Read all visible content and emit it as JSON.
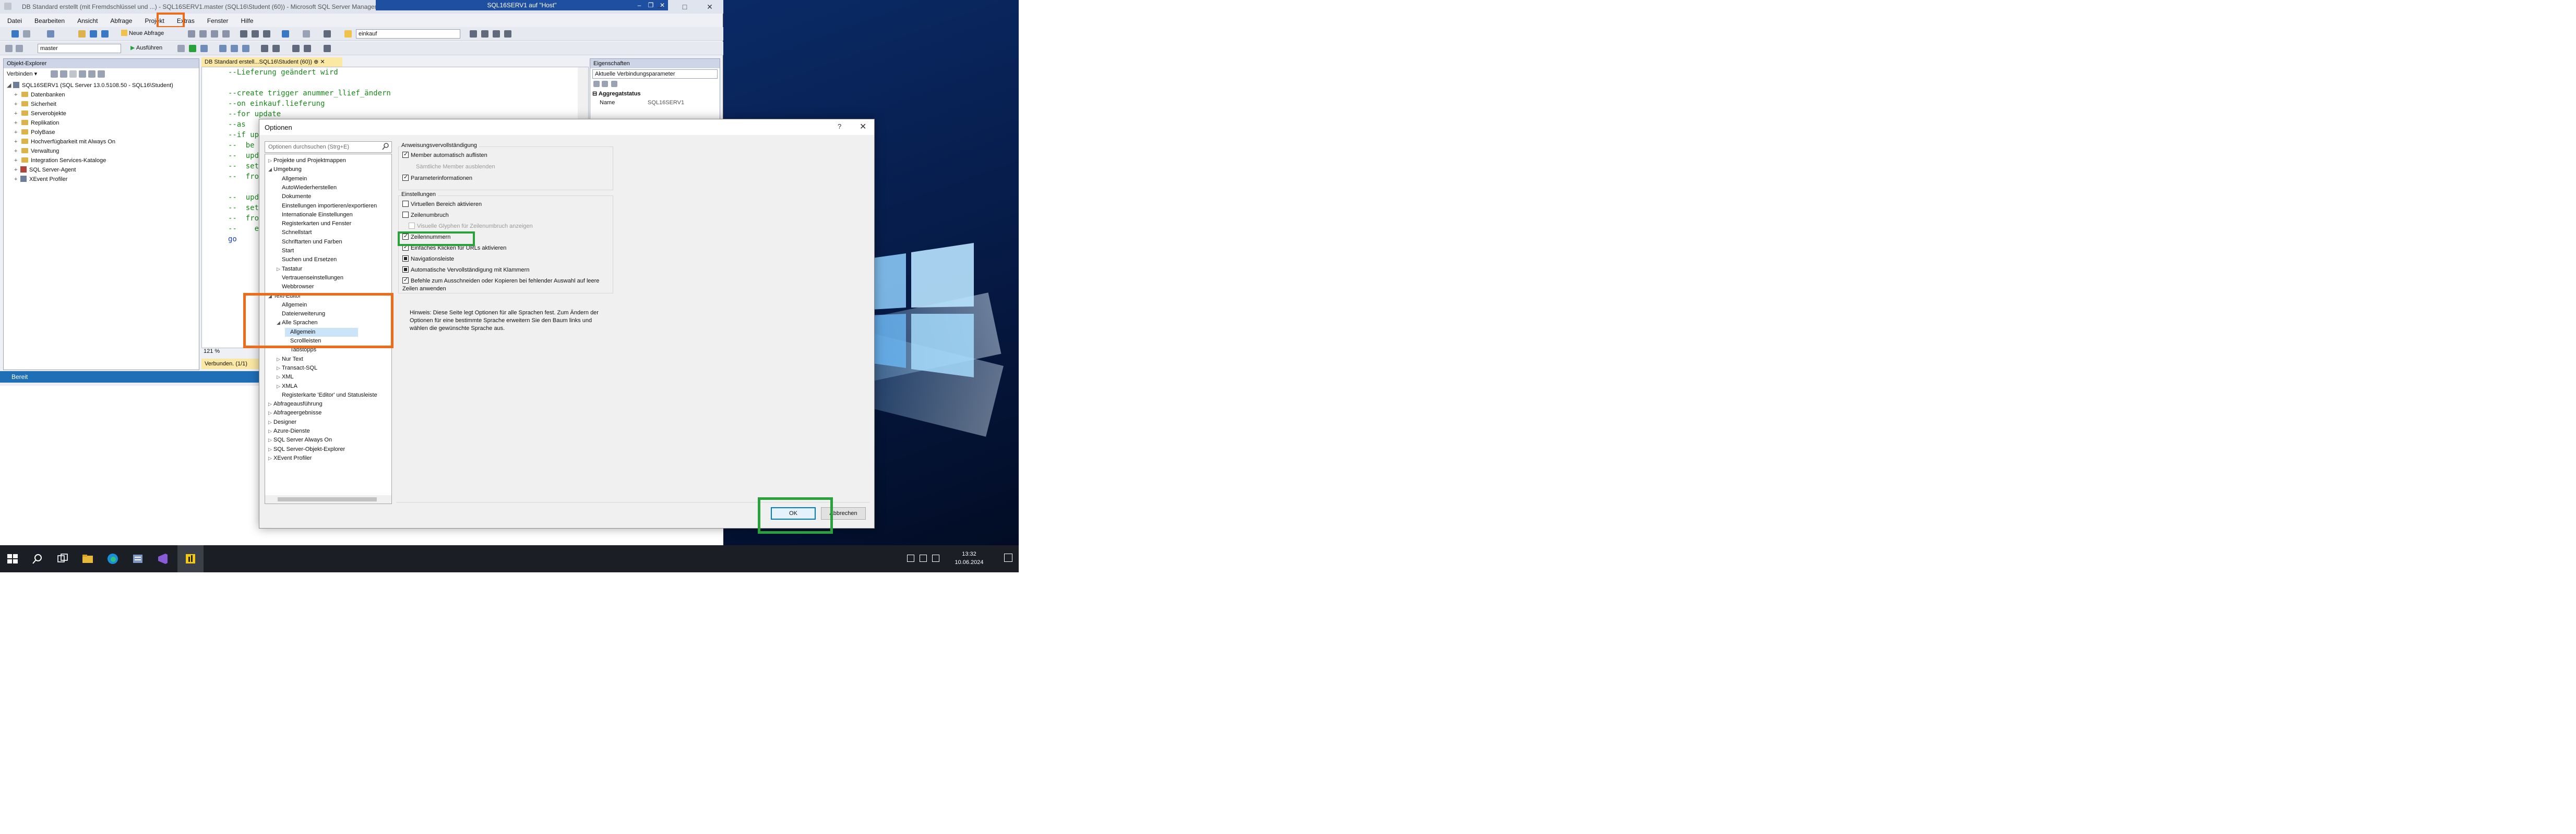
{
  "window": {
    "title": "DB Standard erstellt (mit Fremdschlüssel und ...) - SQL16SERV1.master (SQL16\\Student (60)) - Microsoft SQL Server Management Studio",
    "rdp_title": "SQL16SERV1 auf \"Host\""
  },
  "menu": [
    "Datei",
    "Bearbeiten",
    "Ansicht",
    "Abfrage",
    "Projekt",
    "Extras",
    "Fenster",
    "Hilfe"
  ],
  "toolbar": {
    "new_query": "Neue Abfrage",
    "db_select": "master",
    "execute": "Ausführen",
    "search_box": "einkauf"
  },
  "object_explorer": {
    "title": "Objekt-Explorer",
    "connect": "Verbinden",
    "server": "SQL16SERV1 (SQL Server 13.0.5108.50 - SQL16\\Student)",
    "items": [
      "Datenbanken",
      "Sicherheit",
      "Serverobjekte",
      "Replikation",
      "PolyBase",
      "Hochverfügbarkeit mit Always On",
      "Verwaltung",
      "Integration Services-Kataloge",
      "SQL Server-Agent",
      "XEvent Profiler"
    ]
  },
  "editor": {
    "tab": "DB Standard erstell...SQL16\\Student (60))",
    "lines": [
      "--Lieferung geändert wird",
      "",
      "--create trigger anummer_llief_ändern",
      "--on einkauf.lieferung",
      "--for update",
      "--as",
      "--if up",
      "--  be",
      "--  upd",
      "--  set",
      "--  fro",
      "",
      "--  upd",
      "--  set",
      "--  fro",
      "--    e",
      "go"
    ],
    "zoom": "121 %",
    "connected": "Verbunden. (1/1)"
  },
  "properties": {
    "title": "Eigenschaften",
    "selector": "Aktuelle Verbindungsparameter",
    "section": "Aggregatstatus",
    "row_label": "Name",
    "row_value": "SQL16SERV1"
  },
  "status_bar": "Bereit",
  "dialog": {
    "title": "Optionen",
    "help": "?",
    "close": "✕",
    "search_placeholder": "Optionen durchsuchen (Strg+E)",
    "tree": [
      {
        "label": "Projekte und Projektmappen",
        "indent": 0,
        "arrow": "▷"
      },
      {
        "label": "Umgebung",
        "indent": 0,
        "arrow": "◢"
      },
      {
        "label": "Allgemein",
        "indent": 1,
        "arrow": ""
      },
      {
        "label": "AutoWiederherstellen",
        "indent": 1,
        "arrow": ""
      },
      {
        "label": "Dokumente",
        "indent": 1,
        "arrow": ""
      },
      {
        "label": "Einstellungen importieren/exportieren",
        "indent": 1,
        "arrow": ""
      },
      {
        "label": "Internationale Einstellungen",
        "indent": 1,
        "arrow": ""
      },
      {
        "label": "Registerkarten und Fenster",
        "indent": 1,
        "arrow": ""
      },
      {
        "label": "Schnellstart",
        "indent": 1,
        "arrow": ""
      },
      {
        "label": "Schriftarten und Farben",
        "indent": 1,
        "arrow": ""
      },
      {
        "label": "Start",
        "indent": 1,
        "arrow": ""
      },
      {
        "label": "Suchen und Ersetzen",
        "indent": 1,
        "arrow": ""
      },
      {
        "label": "Tastatur",
        "indent": 1,
        "arrow": "▷"
      },
      {
        "label": "Vertrauenseinstellungen",
        "indent": 1,
        "arrow": ""
      },
      {
        "label": "Webbrowser",
        "indent": 1,
        "arrow": ""
      },
      {
        "label": "Text-Editor",
        "indent": 0,
        "arrow": "◢"
      },
      {
        "label": "Allgemein",
        "indent": 1,
        "arrow": ""
      },
      {
        "label": "Dateierweiterung",
        "indent": 1,
        "arrow": ""
      },
      {
        "label": "Alle Sprachen",
        "indent": 1,
        "arrow": "◢"
      },
      {
        "label": "Allgemein",
        "indent": 2,
        "arrow": "",
        "selected": true
      },
      {
        "label": "Scrollleisten",
        "indent": 2,
        "arrow": ""
      },
      {
        "label": "Tabstopps",
        "indent": 2,
        "arrow": ""
      },
      {
        "label": "Nur Text",
        "indent": 1,
        "arrow": "▷"
      },
      {
        "label": "Transact-SQL",
        "indent": 1,
        "arrow": "▷"
      },
      {
        "label": "XML",
        "indent": 1,
        "arrow": "▷"
      },
      {
        "label": "XMLA",
        "indent": 1,
        "arrow": "▷"
      },
      {
        "label": "Registerkarte 'Editor' und Statusleiste",
        "indent": 1,
        "arrow": ""
      },
      {
        "label": "Abfrageausführung",
        "indent": 0,
        "arrow": "▷"
      },
      {
        "label": "Abfrageergebnisse",
        "indent": 0,
        "arrow": "▷"
      },
      {
        "label": "Designer",
        "indent": 0,
        "arrow": "▷"
      },
      {
        "label": "Azure-Dienste",
        "indent": 0,
        "arrow": "▷"
      },
      {
        "label": "SQL Server Always On",
        "indent": 0,
        "arrow": "▷"
      },
      {
        "label": "SQL Server-Objekt-Explorer",
        "indent": 0,
        "arrow": "▷"
      },
      {
        "label": "XEvent Profiler",
        "indent": 0,
        "arrow": "▷"
      }
    ],
    "groups": {
      "statement_completion": "Anweisungsvervollständigung",
      "settings": "Einstellungen"
    },
    "options_completion": [
      {
        "label": "Member automatisch auflisten",
        "checked": true,
        "disabled": false
      },
      {
        "label": "Sämtliche Member ausblenden",
        "checked": false,
        "disabled": true,
        "nobox": true
      },
      {
        "label": "Parameterinformationen",
        "checked": true,
        "disabled": false
      }
    ],
    "options_settings": [
      {
        "label": "Virtuellen Bereich aktivieren",
        "checked": false,
        "disabled": false
      },
      {
        "label": "Zeilenumbruch",
        "checked": false,
        "disabled": false
      },
      {
        "label": "Visuelle Glyphen für Zeilenumbruch anzeigen",
        "checked": false,
        "disabled": true
      },
      {
        "label": "Zeilennummern",
        "checked": true,
        "disabled": false
      },
      {
        "label": "Einfaches Klicken für URLs aktivieren",
        "checked": true,
        "disabled": false
      },
      {
        "label": "Navigationsleiste",
        "checked": "partial",
        "disabled": false
      },
      {
        "label": "Automatische Vervollständigung mit Klammern",
        "checked": "partial",
        "disabled": false
      },
      {
        "label": "Befehle zum Ausschneiden oder Kopieren bei fehlender Auswahl auf leere Zeilen anwenden",
        "checked": true,
        "disabled": false
      }
    ],
    "note": "Hinweis: Diese Seite legt Optionen für alle Sprachen fest. Zum Ändern der Optionen für eine bestimmte Sprache erweitern Sie den Baum links und wählen die gewünschte Sprache aus.",
    "ok": "OK",
    "cancel": "Abbrechen"
  },
  "taskbar": {
    "time": "13:32",
    "date": "10.06.2024"
  },
  "colors": {
    "highlight_orange": "#ec6c1c",
    "highlight_green": "#2aa13c",
    "status_blue": "#1f6fb6",
    "editor_comment": "#1a8a1a"
  }
}
